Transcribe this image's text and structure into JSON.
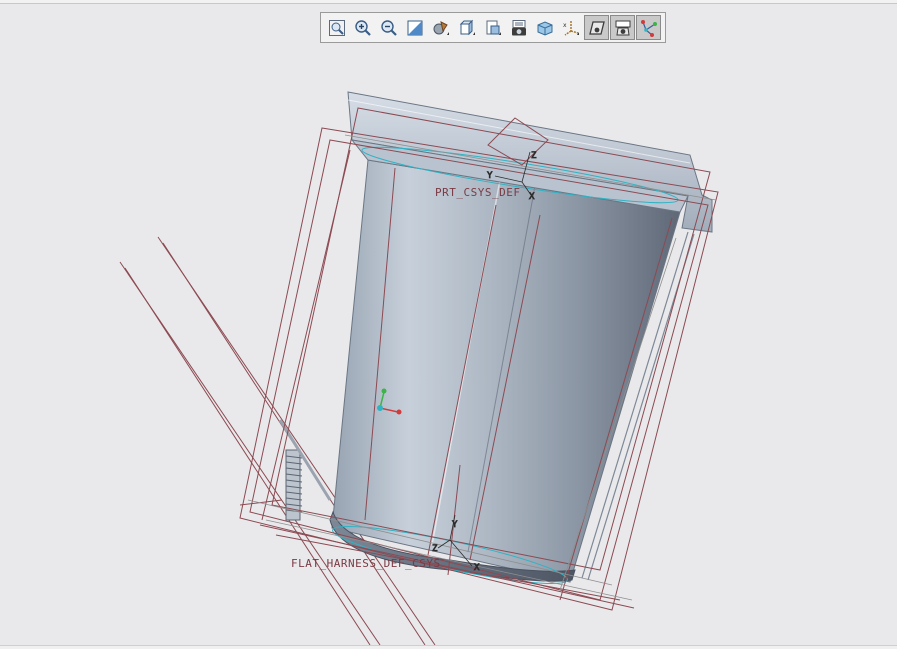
{
  "viewport": {
    "background": "#e9e9eb",
    "datum_color": "#8c4a52",
    "model_color": "#a8b3c1"
  },
  "toolbar": {
    "buttons": [
      {
        "id": "refit",
        "icon": "refit-icon",
        "active": false
      },
      {
        "id": "zoom-in",
        "icon": "zoom-in-icon",
        "active": false
      },
      {
        "id": "zoom-out",
        "icon": "zoom-out-icon",
        "active": false
      },
      {
        "id": "repaint",
        "icon": "repaint-icon",
        "active": false
      },
      {
        "id": "display-style",
        "icon": "display-style-icon",
        "active": false
      },
      {
        "id": "saved-orientations",
        "icon": "saved-orientations-icon",
        "active": false
      },
      {
        "id": "view-manager",
        "icon": "view-manager-icon",
        "active": false
      },
      {
        "id": "perspective-view",
        "icon": "camera-icon",
        "active": false
      },
      {
        "id": "named-views",
        "icon": "view-cube-icon",
        "active": false
      },
      {
        "id": "datum-display",
        "icon": "datum-display-icon",
        "active": false
      },
      {
        "id": "plane-display",
        "icon": "datum-plane-icon",
        "active": true
      },
      {
        "id": "spin-center",
        "icon": "spin-center-icon",
        "active": true
      },
      {
        "id": "csys-display",
        "icon": "csys-icon",
        "active": true
      }
    ]
  },
  "csys": {
    "top_label": "PRT_CSYS_DEF",
    "bottom_label": "FLAT_HARNESS_DEF_CSYS",
    "axis_x": "X",
    "axis_y": "Y",
    "axis_z": "Z"
  }
}
